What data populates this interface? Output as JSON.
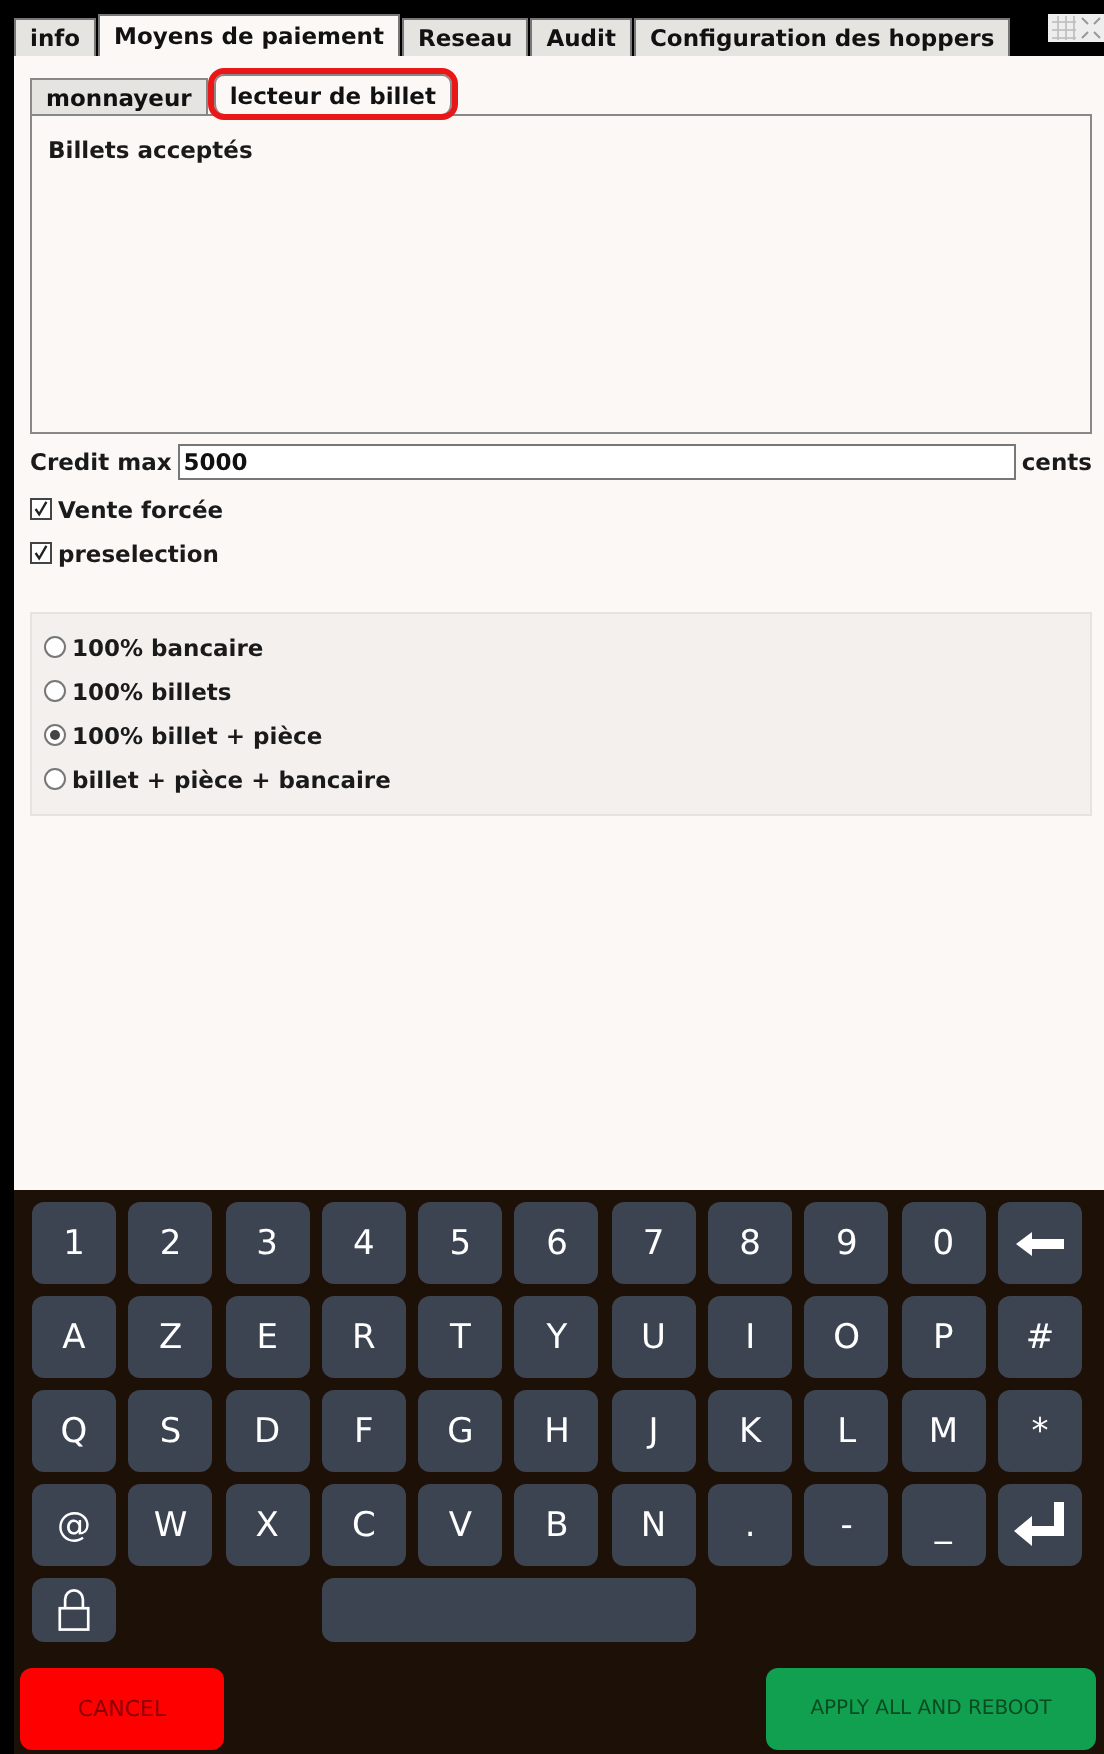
{
  "tabs": [
    {
      "label": "info",
      "selected": false
    },
    {
      "label": "Moyens de paiement",
      "selected": true
    },
    {
      "label": "Reseau",
      "selected": false
    },
    {
      "label": "Audit",
      "selected": false
    },
    {
      "label": "Configuration des hoppers",
      "selected": false
    }
  ],
  "subtabs": [
    {
      "label": "monnayeur",
      "selected": false,
      "highlighted": false
    },
    {
      "label": "lecteur de billet",
      "selected": true,
      "highlighted": true
    }
  ],
  "panel": {
    "title": "Billets acceptés"
  },
  "credit_max": {
    "label": "Credit max",
    "value": "5000",
    "unit": "cents"
  },
  "checkboxes": [
    {
      "label": "Vente forcée",
      "checked": true
    },
    {
      "label": "preselection",
      "checked": true
    }
  ],
  "payment_modes": [
    {
      "label": "100% bancaire",
      "selected": false
    },
    {
      "label": "100% billets",
      "selected": false
    },
    {
      "label": "100% billet + pièce",
      "selected": true
    },
    {
      "label": "billet + pièce + bancaire",
      "selected": false
    }
  ],
  "keyboard": {
    "rows": [
      [
        {
          "kind": "char",
          "label": "1"
        },
        {
          "kind": "char",
          "label": "2"
        },
        {
          "kind": "char",
          "label": "3"
        },
        {
          "kind": "char",
          "label": "4"
        },
        {
          "kind": "char",
          "label": "5"
        },
        {
          "kind": "char",
          "label": "6"
        },
        {
          "kind": "char",
          "label": "7"
        },
        {
          "kind": "char",
          "label": "8"
        },
        {
          "kind": "char",
          "label": "9"
        },
        {
          "kind": "char",
          "label": "0"
        },
        {
          "kind": "backspace"
        }
      ],
      [
        {
          "kind": "char",
          "label": "A"
        },
        {
          "kind": "char",
          "label": "Z"
        },
        {
          "kind": "char",
          "label": "E"
        },
        {
          "kind": "char",
          "label": "R"
        },
        {
          "kind": "char",
          "label": "T"
        },
        {
          "kind": "char",
          "label": "Y"
        },
        {
          "kind": "char",
          "label": "U"
        },
        {
          "kind": "char",
          "label": "I"
        },
        {
          "kind": "char",
          "label": "O"
        },
        {
          "kind": "char",
          "label": "P"
        },
        {
          "kind": "char",
          "label": "#"
        }
      ],
      [
        {
          "kind": "char",
          "label": "Q"
        },
        {
          "kind": "char",
          "label": "S"
        },
        {
          "kind": "char",
          "label": "D"
        },
        {
          "kind": "char",
          "label": "F"
        },
        {
          "kind": "char",
          "label": "G"
        },
        {
          "kind": "char",
          "label": "H"
        },
        {
          "kind": "char",
          "label": "J"
        },
        {
          "kind": "char",
          "label": "K"
        },
        {
          "kind": "char",
          "label": "L"
        },
        {
          "kind": "char",
          "label": "M"
        },
        {
          "kind": "char",
          "label": "*"
        }
      ],
      [
        {
          "kind": "char",
          "label": "@"
        },
        {
          "kind": "char",
          "label": "W"
        },
        {
          "kind": "char",
          "label": "X"
        },
        {
          "kind": "char",
          "label": "C"
        },
        {
          "kind": "char",
          "label": "V"
        },
        {
          "kind": "char",
          "label": "B"
        },
        {
          "kind": "char",
          "label": "N"
        },
        {
          "kind": "char",
          "label": "."
        },
        {
          "kind": "char",
          "label": "-"
        },
        {
          "kind": "char",
          "label": "_"
        },
        {
          "kind": "enter"
        }
      ],
      [
        {
          "kind": "lock"
        },
        {
          "kind": "gap"
        },
        {
          "kind": "gap"
        },
        {
          "kind": "space"
        },
        {
          "kind": "gap"
        },
        {
          "kind": "gap"
        },
        {
          "kind": "gap"
        },
        {
          "kind": "gap"
        },
        {
          "kind": "gap"
        },
        {
          "kind": "gap"
        },
        {
          "kind": "gap"
        }
      ]
    ]
  },
  "buttons": {
    "cancel": "CANCEL",
    "apply": "APPLY ALL AND REBOOT"
  }
}
